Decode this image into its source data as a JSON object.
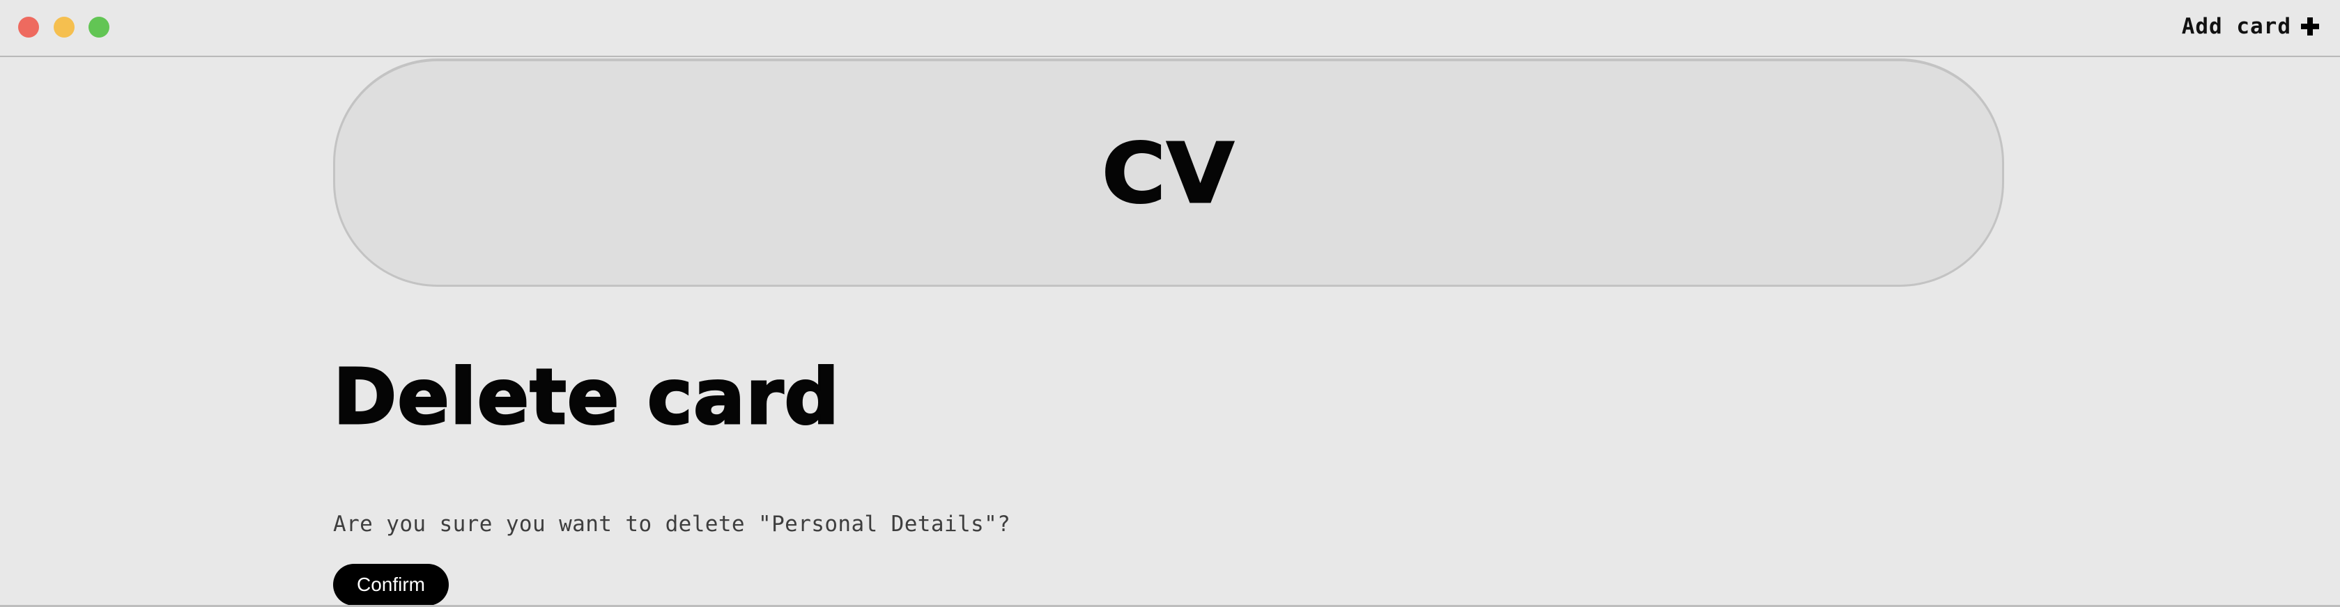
{
  "window": {
    "controls": {
      "close_color": "#ee6a5f",
      "minimize_color": "#f5bf4f",
      "zoom_color": "#62c554"
    }
  },
  "toolbar": {
    "add_card_label": "Add card",
    "add_card_icon": "plus-icon"
  },
  "hero": {
    "title": "CV"
  },
  "main": {
    "title": "Delete card",
    "prompt": "Are you sure you want to delete \"Personal Details\"?",
    "confirm_label": "Confirm"
  }
}
